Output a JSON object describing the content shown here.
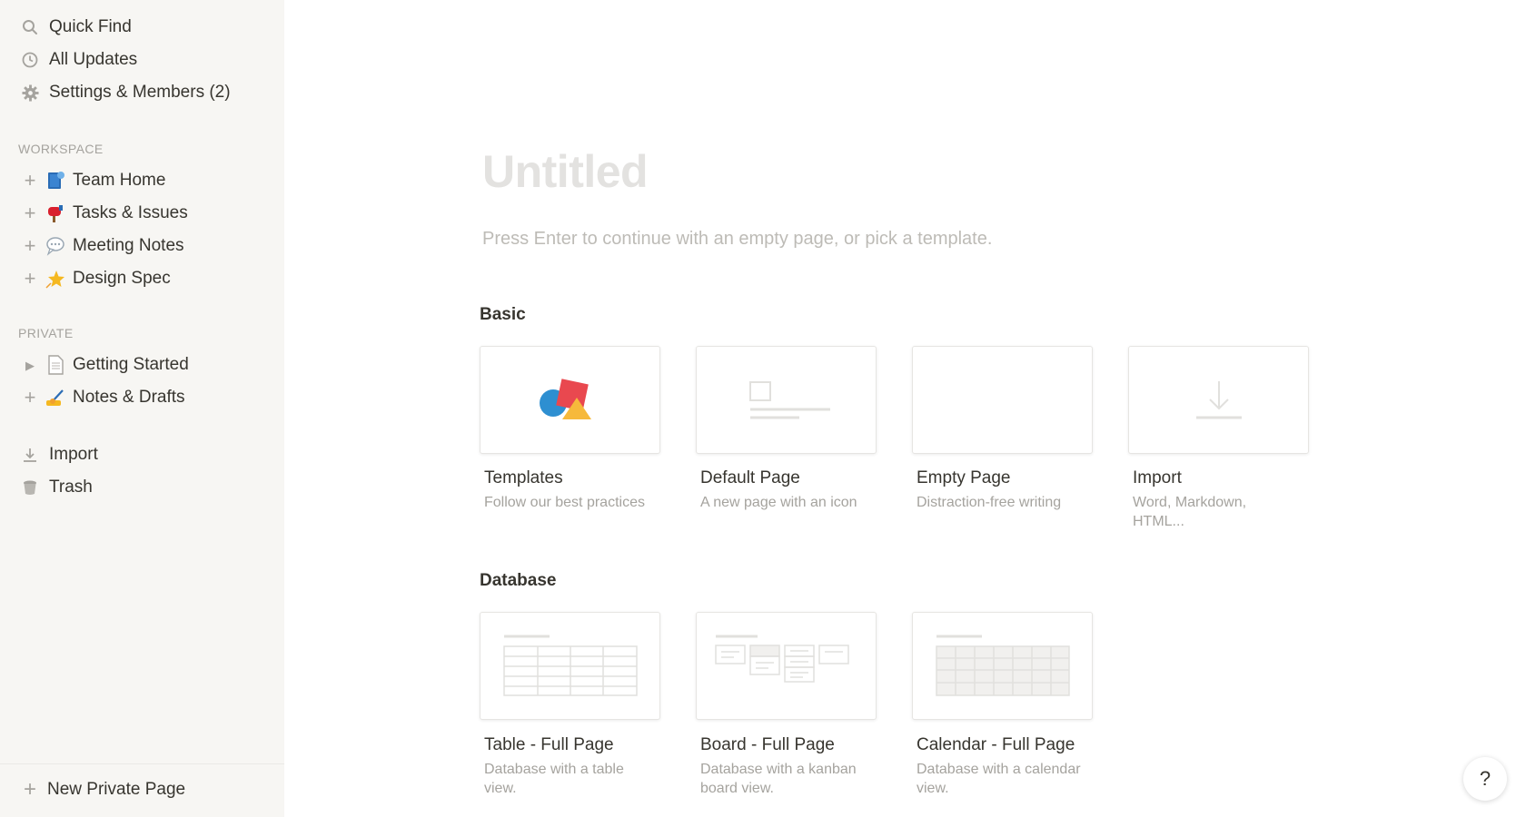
{
  "sidebar": {
    "top_items": [
      {
        "label": "Quick Find",
        "icon": "search-icon"
      },
      {
        "label": "All Updates",
        "icon": "clock-icon"
      },
      {
        "label": "Settings & Members (2)",
        "icon": "gear-icon"
      }
    ],
    "workspace_label": "WORKSPACE",
    "workspace_pages": [
      {
        "label": "Team Home",
        "icon": "book-emoji-icon"
      },
      {
        "label": "Tasks & Issues",
        "icon": "mailbox-emoji-icon"
      },
      {
        "label": "Meeting Notes",
        "icon": "speech-bubble-emoji-icon"
      },
      {
        "label": "Design Spec",
        "icon": "star-emoji-icon"
      }
    ],
    "private_label": "PRIVATE",
    "private_pages": [
      {
        "label": "Getting Started",
        "icon": "document-icon"
      },
      {
        "label": "Notes & Drafts",
        "icon": "writing-hand-emoji-icon"
      }
    ],
    "bottom_items": [
      {
        "label": "Import",
        "icon": "download-icon"
      },
      {
        "label": "Trash",
        "icon": "trash-icon"
      }
    ],
    "new_private_page": "New Private Page"
  },
  "main": {
    "title": "Untitled",
    "subtitle": "Press Enter to continue with an empty page, or pick a template.",
    "basic_label": "Basic",
    "basic": [
      {
        "title": "Templates",
        "desc": "Follow our best practices"
      },
      {
        "title": "Default Page",
        "desc": "A new page with an icon"
      },
      {
        "title": "Empty Page",
        "desc": "Distraction-free writing"
      },
      {
        "title": "Import",
        "desc": "Word, Markdown, HTML..."
      }
    ],
    "database_label": "Database",
    "database": [
      {
        "title": "Table - Full Page",
        "desc": "Database with a table view."
      },
      {
        "title": "Board - Full Page",
        "desc": "Database with a kanban board view."
      },
      {
        "title": "Calendar - Full Page",
        "desc": "Database with a calendar view."
      }
    ]
  },
  "help_label": "?"
}
